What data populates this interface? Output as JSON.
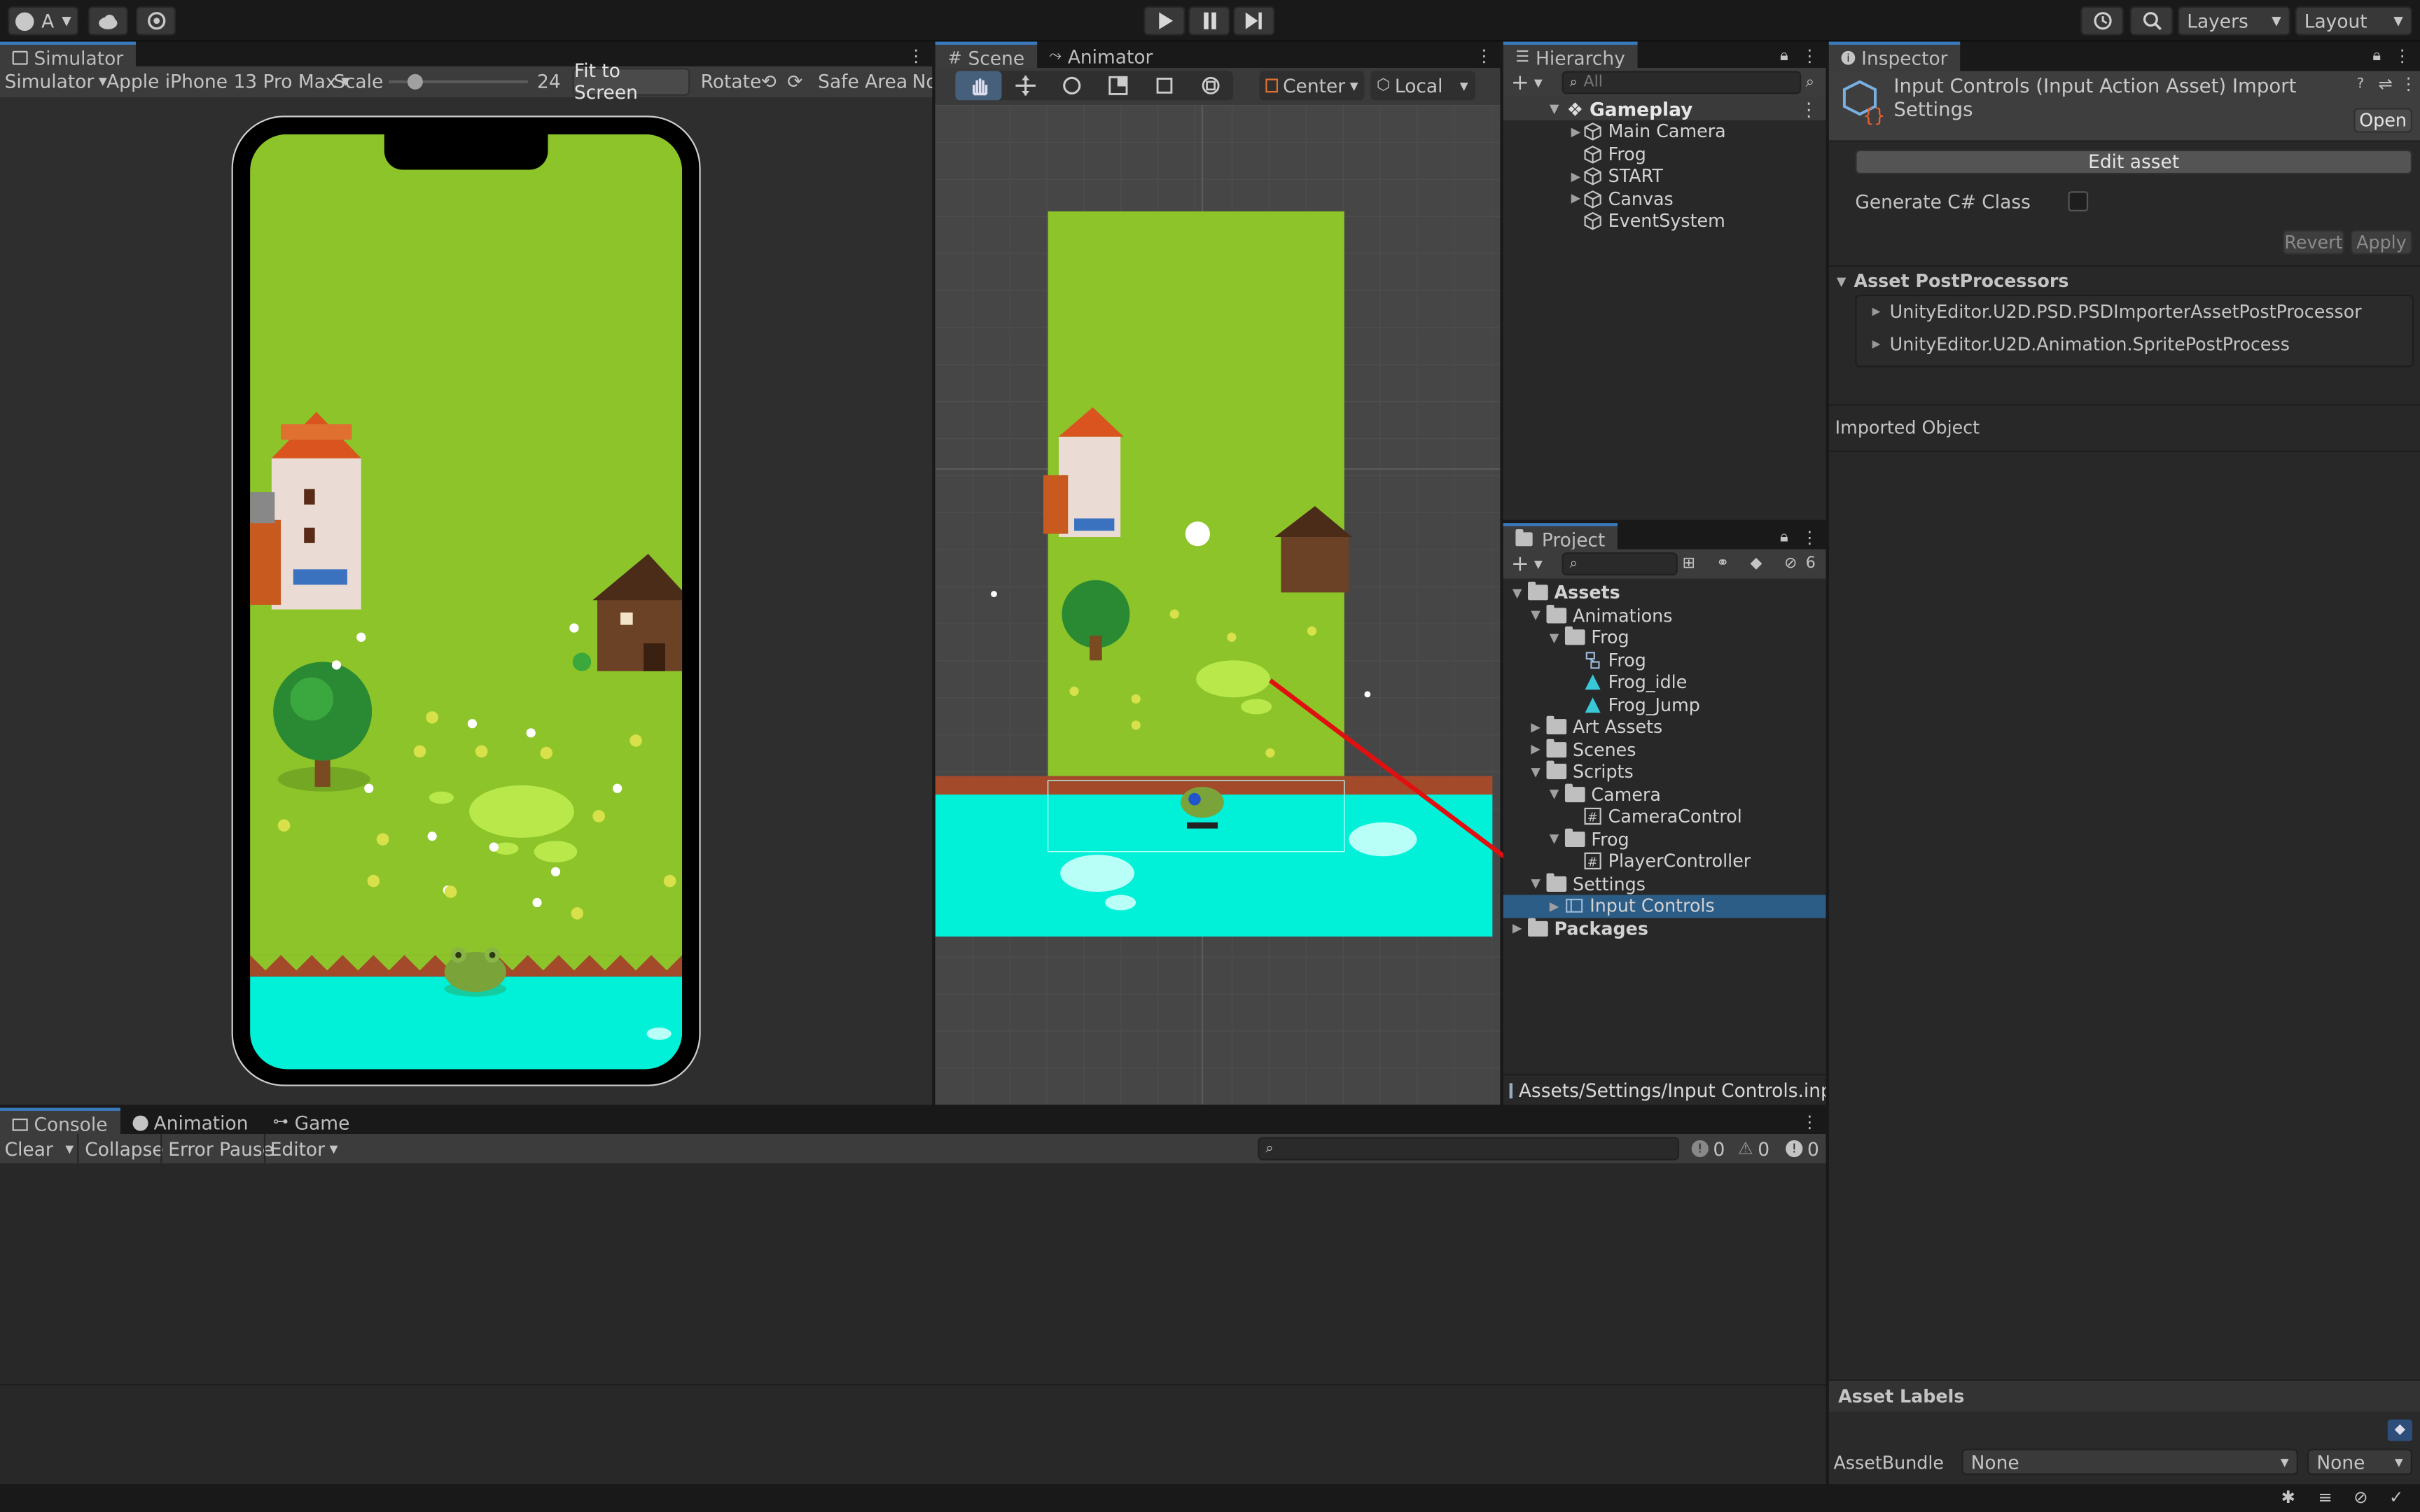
{
  "topbar": {
    "account_label": "A",
    "layers_label": "Layers",
    "layout_label": "Layout"
  },
  "simulator": {
    "tab_label": "Simulator",
    "mode_label": "Simulator",
    "device_label": "Apple iPhone 13 Pro Max",
    "scale_label": "Scale",
    "scale_value": "24",
    "fit_label": "Fit to Screen",
    "rotate_label": "Rotate",
    "safe_area_label": "Safe Area",
    "truncated_label": "No"
  },
  "scene": {
    "tab_label": "Scene",
    "animator_tab_label": "Animator",
    "pivot_label": "Center",
    "space_label": "Local"
  },
  "hierarchy": {
    "tab_label": "Hierarchy",
    "search_placeholder": "All",
    "scene_name": "Gameplay",
    "items": [
      {
        "label": "Main Camera",
        "expandable": true
      },
      {
        "label": "Frog",
        "expandable": false
      },
      {
        "label": "START",
        "expandable": true
      },
      {
        "label": "Canvas",
        "expandable": true
      },
      {
        "label": "EventSystem",
        "expandable": false
      }
    ]
  },
  "project": {
    "tab_label": "Project",
    "hidden_count": "6",
    "tree": [
      {
        "label": "Assets",
        "depth": 0,
        "type": "folder",
        "open": true,
        "bold": true
      },
      {
        "label": "Animations",
        "depth": 1,
        "type": "folder",
        "open": true
      },
      {
        "label": "Frog",
        "depth": 2,
        "type": "folder",
        "open": true
      },
      {
        "label": "Frog",
        "depth": 3,
        "type": "controller"
      },
      {
        "label": "Frog_idle",
        "depth": 3,
        "type": "anim"
      },
      {
        "label": "Frog_Jump",
        "depth": 3,
        "type": "anim"
      },
      {
        "label": "Art Assets",
        "depth": 1,
        "type": "folder",
        "open": false
      },
      {
        "label": "Scenes",
        "depth": 1,
        "type": "folder",
        "open": false
      },
      {
        "label": "Scripts",
        "depth": 1,
        "type": "folder",
        "open": true
      },
      {
        "label": "Camera",
        "depth": 2,
        "type": "folder",
        "open": true
      },
      {
        "label": "CameraControl",
        "depth": 3,
        "type": "script"
      },
      {
        "label": "Frog",
        "depth": 2,
        "type": "folder",
        "open": true
      },
      {
        "label": "PlayerController",
        "depth": 3,
        "type": "script"
      },
      {
        "label": "Settings",
        "depth": 1,
        "type": "folder",
        "open": true
      },
      {
        "label": "Input Controls",
        "depth": 2,
        "type": "input",
        "selected": true
      },
      {
        "label": "Packages",
        "depth": 0,
        "type": "folder",
        "open": false,
        "bold": true
      }
    ],
    "path": "Assets/Settings/Input Controls.inputa"
  },
  "inspector": {
    "tab_label": "Inspector",
    "title": "Input Controls (Input Action Asset) Import Settings",
    "open_label": "Open",
    "edit_asset_label": "Edit asset",
    "generate_label": "Generate C# Class",
    "revert_label": "Revert",
    "apply_label": "Apply",
    "postprocessors_label": "Asset PostProcessors",
    "postprocessors": [
      "UnityEditor.U2D.PSD.PSDImporterAssetPostProcessor",
      "UnityEditor.U2D.Animation.SpritePostProcess"
    ],
    "imported_object_label": "Imported Object",
    "asset_labels_label": "Asset Labels",
    "asset_bundle_label": "AssetBundle",
    "bundle_value": "None",
    "variant_value": "None"
  },
  "console": {
    "tabs": [
      {
        "label": "Console"
      },
      {
        "label": "Animation"
      },
      {
        "label": "Game"
      }
    ],
    "clear_label": "Clear",
    "collapse_label": "Collapse",
    "error_pause_label": "Error Pause",
    "editor_label": "Editor",
    "log_count": "0",
    "warn_count": "0",
    "error_count": "0"
  },
  "colors": {
    "grass": "#8cc42a",
    "water": "#00f0d8",
    "selection": "#2c5d87",
    "accent": "#3a79bb",
    "arrow": "#e01010"
  }
}
